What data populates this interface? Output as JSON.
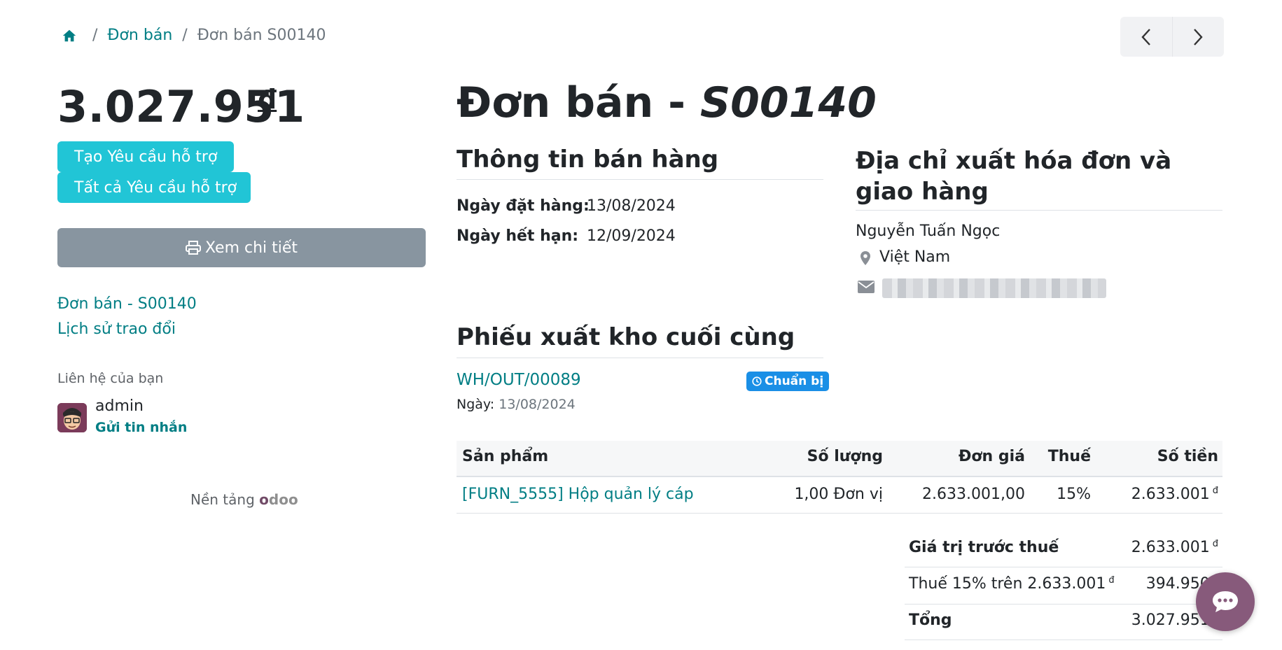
{
  "breadcrumb": {
    "home_icon": "home-icon",
    "items": [
      "Đơn bán",
      "Đơn bán S00140"
    ]
  },
  "pager": {
    "prev_icon": "chevron-left-icon",
    "next_icon": "chevron-right-icon"
  },
  "sidebar": {
    "amount": "3.027.951",
    "currency": "đ",
    "btn_create_ticket": "Tạo Yêu cầu hỗ trợ",
    "btn_all_tickets": "Tất cả Yêu cầu hỗ trợ",
    "btn_view_details": "Xem chi tiết",
    "print_icon": "print-icon",
    "links": [
      "Đơn bán - S00140",
      "Lịch sử trao đổi"
    ],
    "contact_title": "Liên hệ của bạn",
    "contact_name": "admin",
    "contact_action": "Gửi tin nhắn",
    "powered_prefix": "Nền tảng",
    "powered_brand_o": "o",
    "powered_brand_rest": "doo"
  },
  "header": {
    "title_prefix": "Đơn bán - ",
    "title_ref": "S00140"
  },
  "sales_info": {
    "heading": "Thông tin bán hàng",
    "order_date_label": "Ngày đặt hàng:",
    "order_date": "13/08/2024",
    "expiry_label": "Ngày hết hạn:",
    "expiry_date": "12/09/2024"
  },
  "address": {
    "heading": "Địa chỉ xuất hóa đơn và giao hàng",
    "name": "Nguyễn Tuấn Ngọc",
    "country": "Việt Nam",
    "pin_icon": "map-marker-icon",
    "mail_icon": "envelope-icon"
  },
  "picking": {
    "heading": "Phiếu xuất kho cuối cùng",
    "reference": "WH/OUT/00089",
    "status": "Chuẩn bị",
    "status_icon": "clock-icon",
    "date_label": "Ngày:",
    "date": "13/08/2024"
  },
  "order_lines": {
    "headers": [
      "Sản phẩm",
      "Số lượng",
      "Đơn giá",
      "Thuế",
      "Số tiền"
    ],
    "rows": [
      {
        "product": "[FURN_5555] Hộp quản lý cáp",
        "quantity": "1,00 Đơn vị",
        "unit_price": "2.633.001,00",
        "tax": "15%",
        "amount": "2.633.001",
        "currency": "đ"
      }
    ]
  },
  "totals": {
    "untaxed_label": "Giá trị trước thuế",
    "untaxed": "2.633.001",
    "tax_label": "Thuế 15% trên 2.633.001",
    "tax": "394.950",
    "total_label": "Tổng",
    "total": "3.027.951",
    "currency": "đ"
  },
  "chat": {
    "icon": "chat-bubble-icon"
  },
  "colors": {
    "teal": "#017e84",
    "cyan": "#21c5d6",
    "gray_button": "#8895a0",
    "badge": "#1a8fe6",
    "chat": "#875a7b"
  }
}
